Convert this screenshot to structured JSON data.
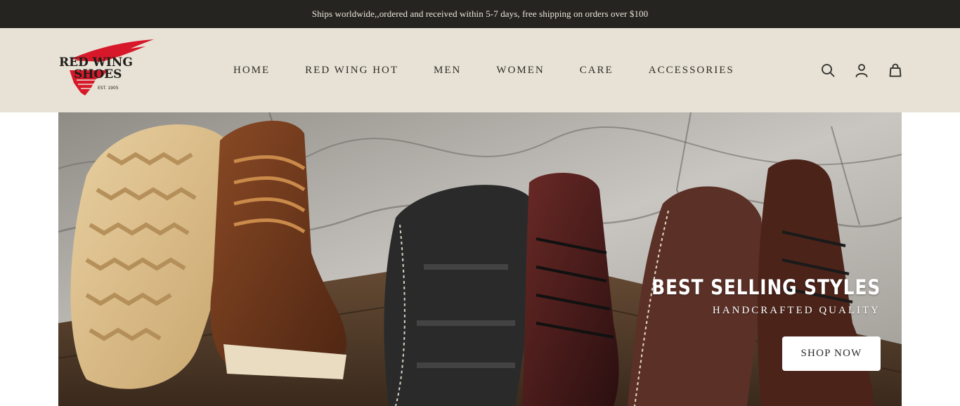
{
  "announcement": "Ships worldwide,,ordered and received within 5-7 days, free shipping on orders over $100",
  "brand": {
    "logo_line1": "RED WING",
    "logo_line2": "SHOES",
    "logo_est": "EST. 1905",
    "accent_color": "#d7182a"
  },
  "nav": {
    "items": [
      "HOME",
      "RED WING HOT",
      "MEN",
      "WOMEN",
      "CARE",
      "ACCESSORIES"
    ]
  },
  "header_icons": [
    "search-icon",
    "account-icon",
    "cart-bag-icon"
  ],
  "hero": {
    "title": "BEST SELLING STYLES",
    "subtitle": "HANDCRAFTED QUALITY",
    "button_label": "SHOP NOW"
  },
  "colors": {
    "announcement_bg": "#262421",
    "header_bg": "#e7e2d5"
  }
}
